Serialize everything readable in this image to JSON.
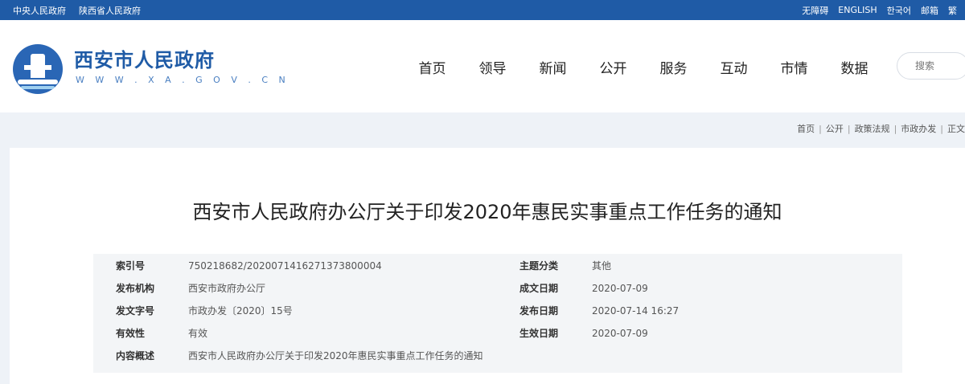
{
  "topbar": {
    "left_links": [
      "中央人民政府",
      "陕西省人民政府"
    ],
    "right_links": [
      "无障碍",
      "ENGLISH",
      "한국어",
      "邮箱",
      "繁"
    ]
  },
  "header": {
    "site_name": "西安市人民政府",
    "site_url": "W W W . X A . G O V . C N",
    "nav": [
      "首页",
      "领导",
      "新闻",
      "公开",
      "服务",
      "互动",
      "市情",
      "数据"
    ],
    "search_placeholder": "搜索"
  },
  "breadcrumb": [
    "首页",
    "公开",
    "政策法规",
    "市政办发",
    "正文"
  ],
  "document": {
    "title": "西安市人民政府办公厅关于印发2020年惠民实事重点工作任务的通知",
    "meta": {
      "index_label": "索引号",
      "index_value": "750218682/202007141627137380000​4",
      "topic_label": "主题分类",
      "topic_value": "其他",
      "issuer_label": "发布机构",
      "issuer_value": "西安市政府办公厅",
      "created_label": "成文日期",
      "created_value": "2020-07-09",
      "docno_label": "发文字号",
      "docno_value": "市政办发〔2020〕15号",
      "published_label": "发布日期",
      "published_value": "2020-07-14 16:27",
      "validity_label": "有效性",
      "validity_value": "有效",
      "effective_label": "生效日期",
      "effective_value": "2020-07-09",
      "summary_label": "内容概述",
      "summary_value": "西安市人民政府办公厅关于印发2020年惠民实事重点工作任务的通知"
    }
  }
}
